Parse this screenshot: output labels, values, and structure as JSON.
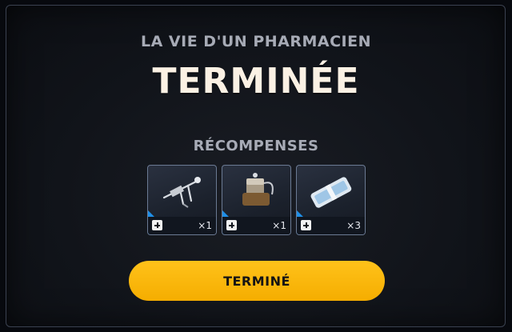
{
  "header": {
    "subtitle": "LA VIE D'UN PHARMACIEN",
    "title": "TERMINÉE"
  },
  "rewards": {
    "label": "RÉCOMPENSES",
    "items": [
      {
        "icon": "drill-weapon-icon",
        "quantity": "×1",
        "accent": "#1f8fe8"
      },
      {
        "icon": "canister-device-icon",
        "quantity": "×1",
        "accent": "#1f8fe8"
      },
      {
        "icon": "medical-bandage-icon",
        "quantity": "×3",
        "accent": "#1f8fe8"
      }
    ]
  },
  "footer": {
    "button_label": "TERMINÉ",
    "button_color": "#ffbb0f"
  }
}
